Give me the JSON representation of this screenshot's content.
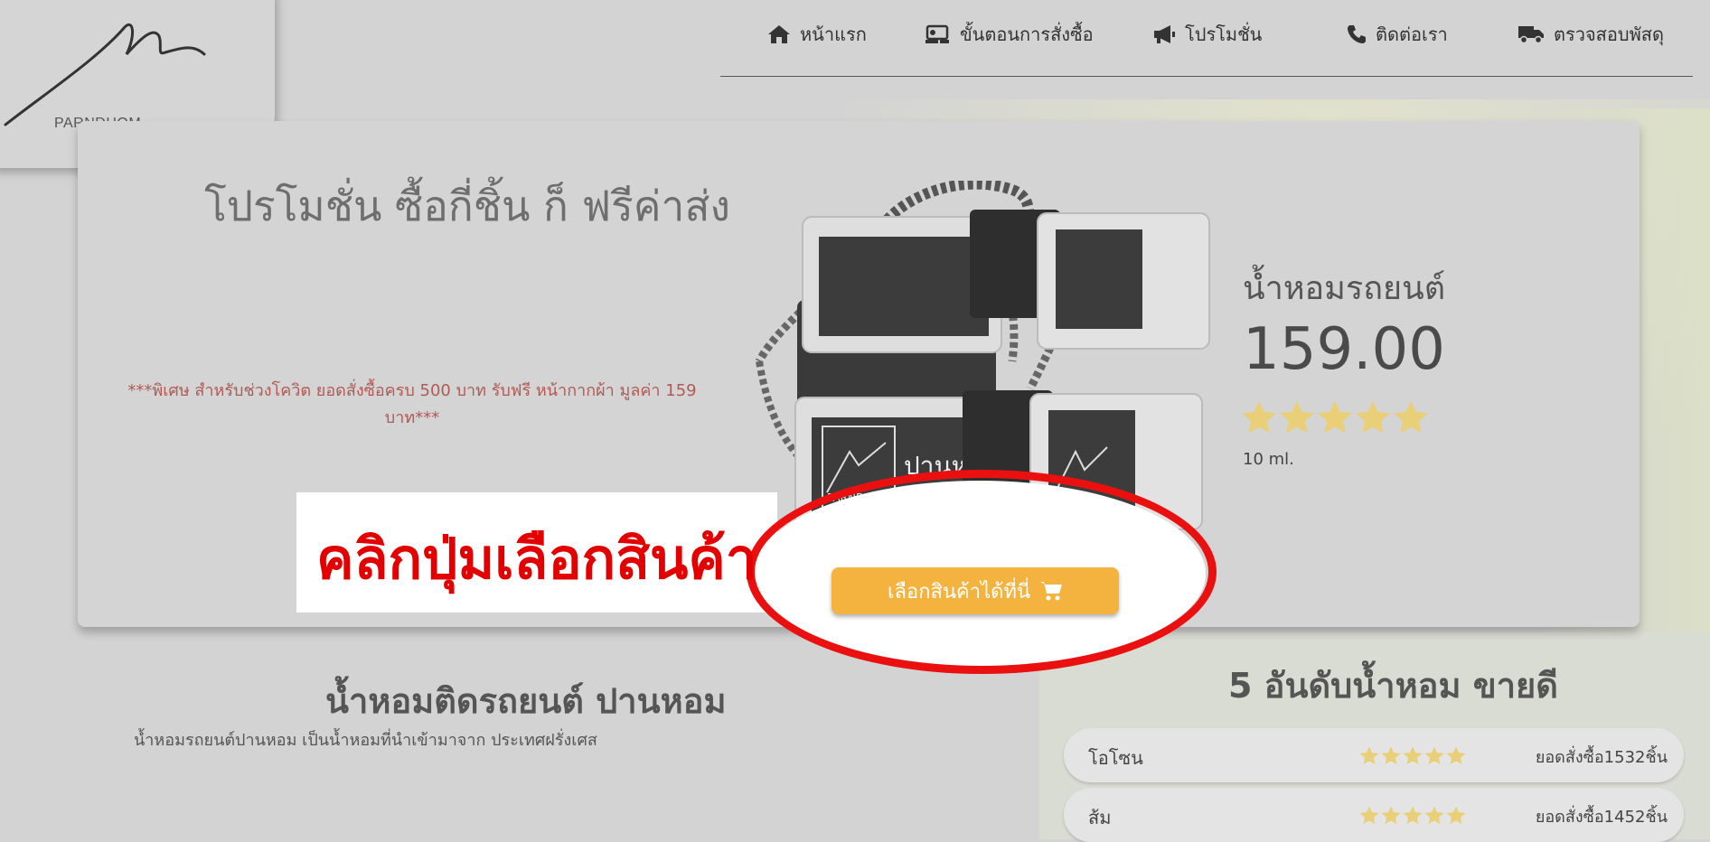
{
  "logo": {
    "brand": "PARNDHOM"
  },
  "nav": [
    {
      "label": "หน้าแรก",
      "icon": "home-icon"
    },
    {
      "label": "ขั้นตอนการสั่งซื้อ",
      "icon": "cart-steps-icon"
    },
    {
      "label": "โปรโมชั่น",
      "icon": "megaphone-icon"
    },
    {
      "label": "ติดต่อเรา",
      "icon": "phone-icon"
    },
    {
      "label": "ตรวจสอบพัสดุ",
      "icon": "truck-icon"
    }
  ],
  "hero": {
    "promo_title": "โปรโมชั่น ซื้อกี่ชิ้น ก็ ฟรีค่าส่ง",
    "promo_note_line1": "***พิเศษ สำหรับช่วงโควิต ยอดสั่งซื้อครบ 500 บาท รับฟรี หน้ากากผ้า มูลค่า 159",
    "promo_note_line2": "บาท***",
    "product_name": "น้ำหอมรถยนต์",
    "product_price": "159.00",
    "product_rating": 5,
    "product_size": "10 ml.",
    "callout": "คลิกปุ่มเลือกสินค้า",
    "select_button": "เลือกสินค้าได้ที่นี่",
    "bottle_label": "ปานหอม",
    "bottle_brand": "PARNDHOM"
  },
  "about": {
    "title": "น้ำหอมติดรถยนต์ ปานหอม",
    "description": "น้ำหอมรถยนต์ปานหอม เป็นน้ำหอมที่นำเข้ามาจาก ประเทศฝรั่งเศส"
  },
  "top5": {
    "title": "5 อันดับน้ำหอม ขายดี",
    "items": [
      {
        "name": "โอโซน",
        "rating": 5,
        "sales": "ยอดสั่งซื้อ1532ชิ้น"
      },
      {
        "name": "ส้ม",
        "rating": 5,
        "sales": "ยอดสั่งซื้อ1452ชิ้น"
      }
    ]
  },
  "colors": {
    "accent_button": "#f3b33e",
    "callout_red": "#e30000",
    "star": "#e8cf78"
  }
}
